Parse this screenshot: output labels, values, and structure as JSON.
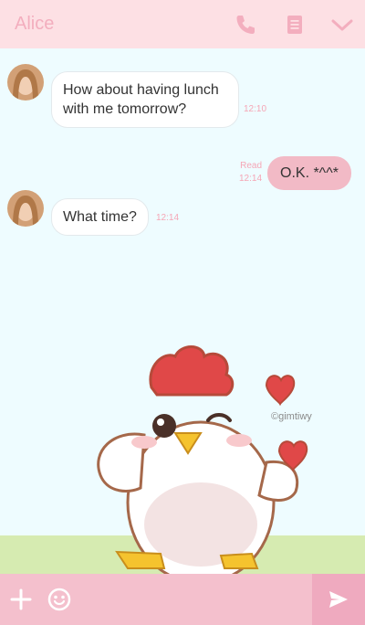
{
  "header": {
    "title": "Alice",
    "icons": [
      "phone-icon",
      "notes-icon",
      "chevron-down-icon"
    ]
  },
  "messages": [
    {
      "direction": "in",
      "lines": [
        "How about having lunch",
        "with me tomorrow?"
      ],
      "time": "12:10"
    },
    {
      "direction": "out",
      "text": "O.K. *^^*",
      "read_label": "Read",
      "time": "12:14"
    },
    {
      "direction": "in",
      "text": "What time?",
      "time": "12:14"
    }
  ],
  "background": {
    "credit": "©gimtiwy"
  },
  "footer": {
    "icons": [
      "plus-icon",
      "emoji-icon",
      "send-icon"
    ]
  },
  "colors": {
    "header_bg": "#fde0e4",
    "title": "#f3aebe",
    "chat_bg": "#eefcff",
    "outgoing_bubble": "#f2bac6",
    "timestamp": "#f5a6b6",
    "footer_bg": "#f4c0cd",
    "send_bg": "#efaabf"
  }
}
